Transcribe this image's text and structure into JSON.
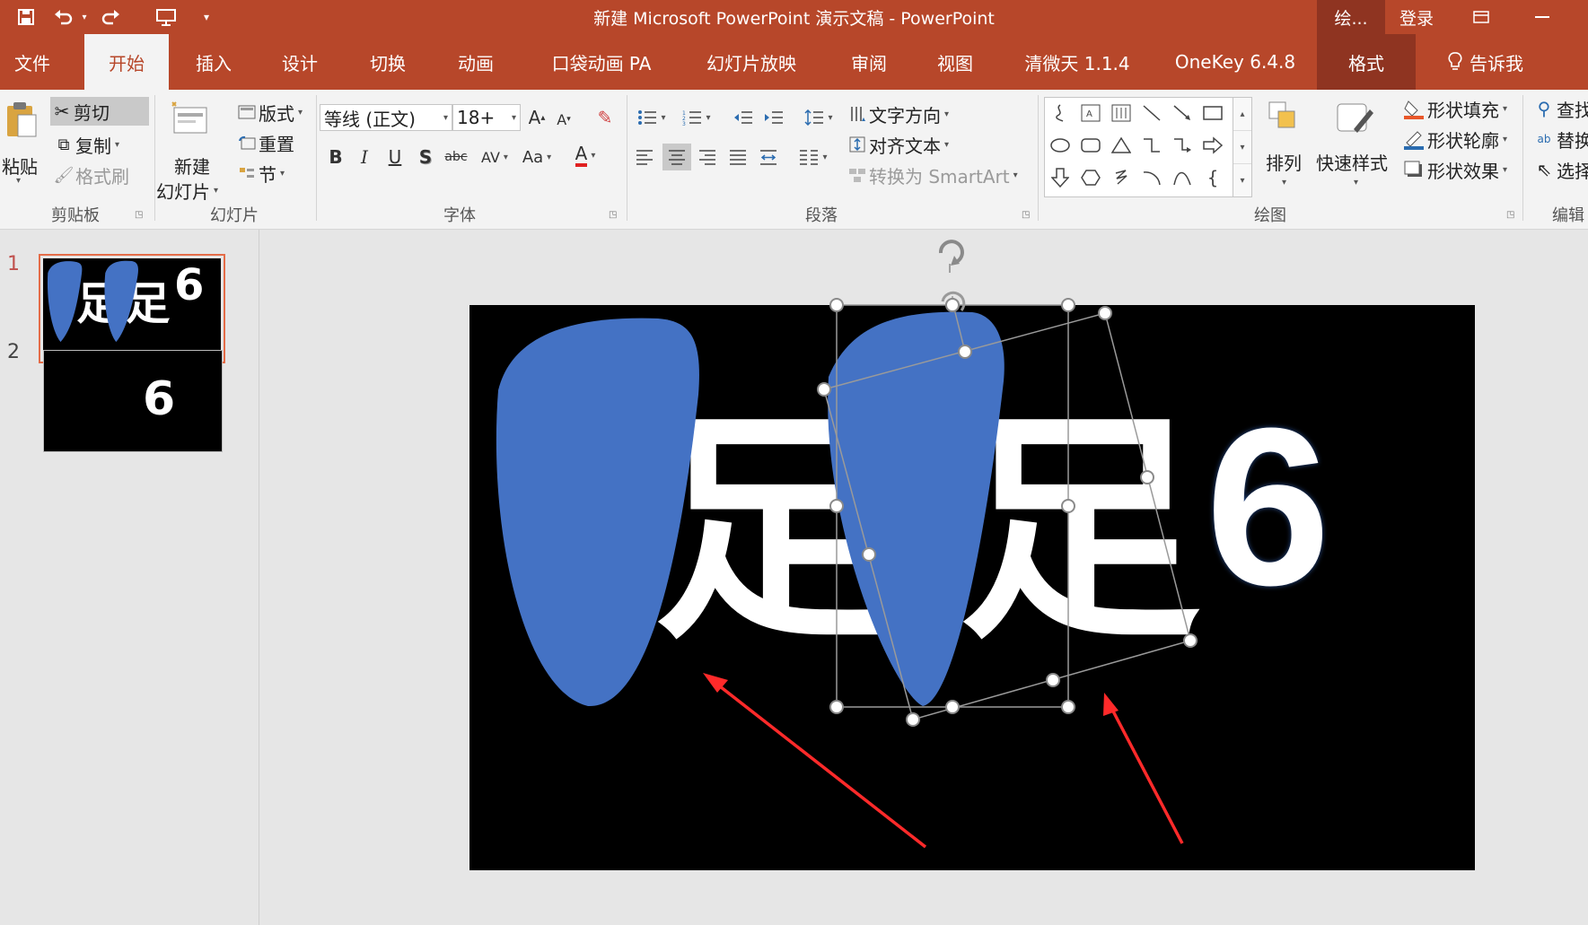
{
  "window": {
    "title": "新建 Microsoft PowerPoint 演示文稿  -  PowerPoint",
    "context_tab": "绘...",
    "signin": "登录"
  },
  "tabs": [
    "文件",
    "开始",
    "插入",
    "设计",
    "切换",
    "动画",
    "口袋动画 PA",
    "幻灯片放映",
    "审阅",
    "视图",
    "清微天 1.1.4",
    "OneKey 6.4.8",
    "格式",
    "告诉我"
  ],
  "ribbon": {
    "clipboard": {
      "paste": "粘贴",
      "cut": "剪切",
      "copy": "复制",
      "format_painter": "格式刷",
      "label": "剪贴板"
    },
    "slides": {
      "new_slide_1": "新建",
      "new_slide_2": "幻灯片",
      "layout": "版式",
      "reset": "重置",
      "section": "节",
      "label": "幻灯片"
    },
    "font": {
      "name": "等线 (正文)",
      "size": "18+",
      "label": "字体"
    },
    "paragraph": {
      "text_direction": "文字方向",
      "align_text": "对齐文本",
      "smartart": "转换为 SmartArt",
      "label": "段落"
    },
    "drawing": {
      "arrange": "排列",
      "quick_styles": "快速样式",
      "shape_fill": "形状填充",
      "shape_outline": "形状轮廓",
      "shape_effects": "形状效果",
      "label": "绘图"
    },
    "editing": {
      "find": "查找",
      "replace": "替换",
      "select": "选择",
      "label": "编辑"
    }
  },
  "slides": [
    {
      "number": "1",
      "text": "6"
    },
    {
      "number": "2",
      "text": "6"
    }
  ],
  "slide_main": {
    "text": "6",
    "shape_color": "#4472c4"
  },
  "colors": {
    "accent": "#b7472a",
    "format_tab": "#8f3421",
    "shape": "#4472c4",
    "arrow": "#ff2a2a"
  }
}
